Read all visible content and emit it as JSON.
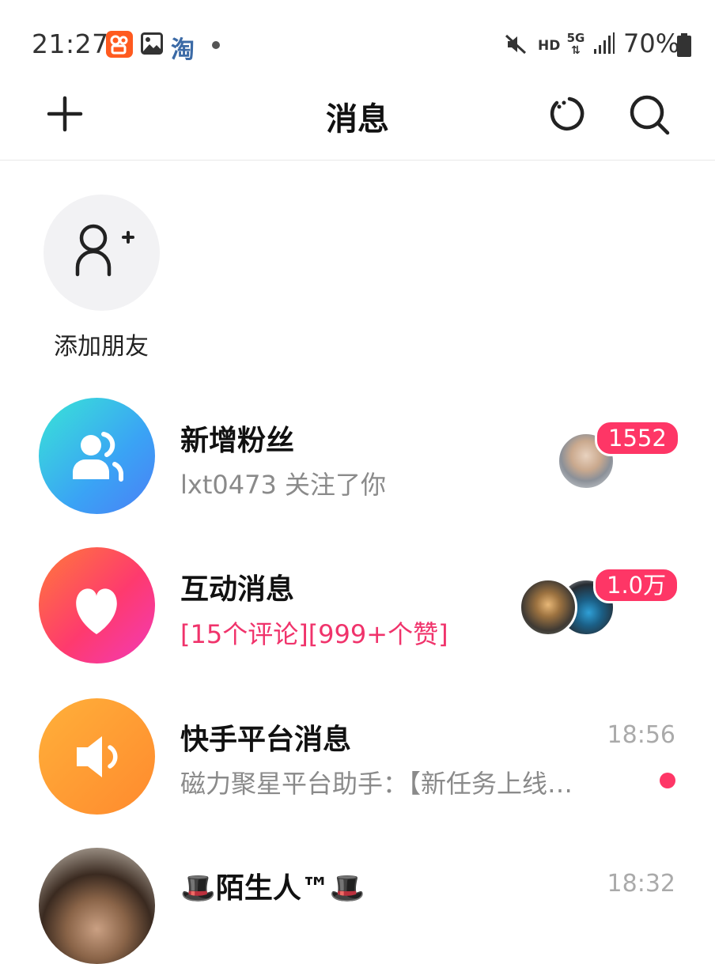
{
  "status_bar": {
    "time": "21:27",
    "app_icons": [
      "kuaishou-icon",
      "gallery-icon",
      "taobao-icon"
    ],
    "taobao_glyph": "淘",
    "mute": "mute-icon",
    "hd": "HD",
    "network": "5G",
    "battery": "70%"
  },
  "header": {
    "title": "消息",
    "left_icon": "plus-icon",
    "right_icons": [
      "refresh-icon",
      "search-icon"
    ]
  },
  "add_friend": {
    "label": "添加朋友"
  },
  "conversations": [
    {
      "title": "新增粉丝",
      "subtitle": "lxt0473 关注了你",
      "badge": "1552",
      "icon": "fans-icon",
      "accent": "#36a8f4"
    },
    {
      "title": "互动消息",
      "subtitle": "[15个评论][999+个赞]",
      "badge": "1.0万",
      "icon": "heart-icon",
      "accent": "#fe3a78",
      "subtitle_color": "#f0336b"
    },
    {
      "title": "快手平台消息",
      "subtitle": "磁力聚星平台助手：【新任务上线…",
      "time": "18:56",
      "icon": "speaker-icon",
      "accent": "#ff9a2e",
      "unread_dot": true
    },
    {
      "title": "🎩陌生人™🎩",
      "time": "18:32",
      "icon": "avatar"
    }
  ]
}
